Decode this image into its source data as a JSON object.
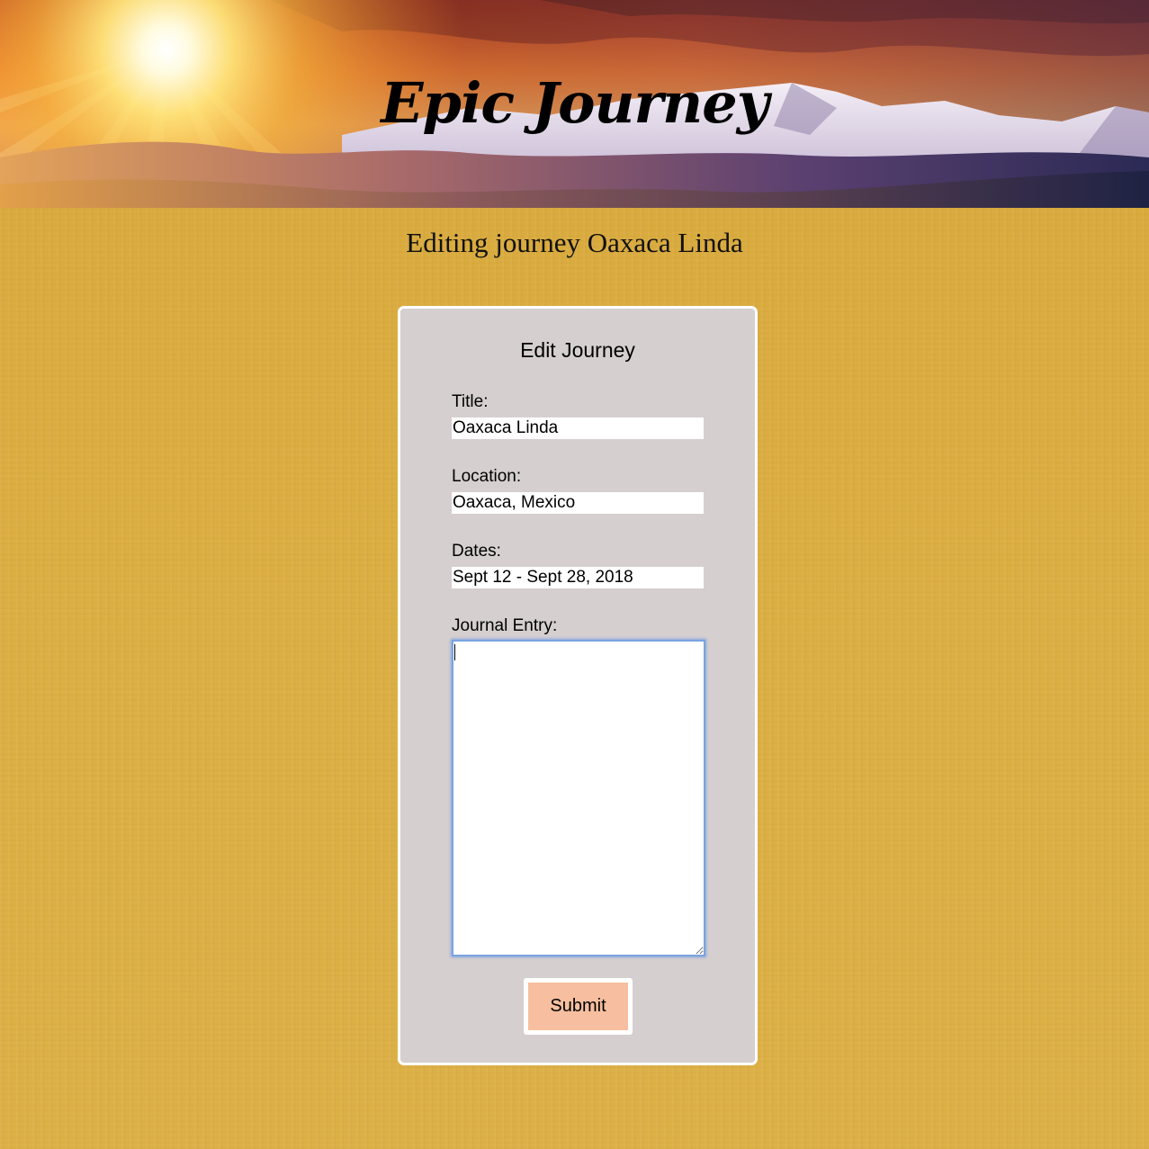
{
  "banner": {
    "title": "Epic Journey"
  },
  "page": {
    "heading": "Editing journey Oaxaca Linda"
  },
  "form": {
    "title": "Edit Journey",
    "fields": {
      "title": {
        "label": "Title:",
        "value": "Oaxaca Linda"
      },
      "location": {
        "label": "Location:",
        "value": "Oaxaca, Mexico"
      },
      "dates": {
        "label": "Dates:",
        "value": "Sept 12 - Sept 28, 2018"
      },
      "journal": {
        "label": "Journal Entry:",
        "value": ""
      }
    },
    "submit_label": "Submit"
  },
  "colors": {
    "page_background": "#dbac3f",
    "card_background": "#d6cfcf",
    "button_background": "#f7bf9f",
    "focus_ring": "#7aa3e0"
  }
}
